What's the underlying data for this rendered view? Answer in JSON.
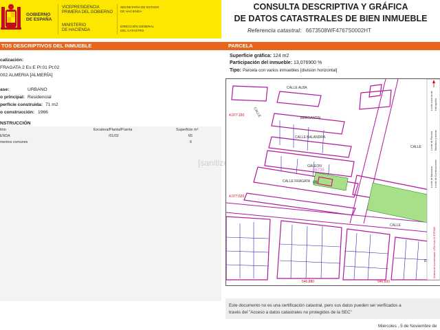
{
  "header": {
    "gov_line1": "GOBIERNO",
    "gov_line2": "DE ESPAÑA",
    "ministry_a1": "VICEPRESIDENCIA",
    "ministry_a2": "PRIMERA DEL GOBIERNO",
    "ministry_b1": "MINISTERIO",
    "ministry_b2": "DE HACIENDA",
    "sec_a1": "SECRETARÍA DE ESTADO",
    "sec_a2": "DE HACIENDA",
    "sec_b1": "DIRECCIÓN GENERAL",
    "sec_b2": "DEL CATASTRO",
    "title_line1": "CONSULTA DESCRIPTIVA Y GRÁFICA",
    "title_line2": "DE DATOS CATASTRALES DE BIEN INMUEBLE",
    "ref_label": "Referencia catastral:",
    "ref_value": "6673508WF4767S0002HT",
    "brand_red": "#c60b1e",
    "brand_yellow": "#fde700",
    "accent_orange": "#e8661c"
  },
  "left": {
    "section_title": "TOS DESCRIPTIVOS DEL INMUEBLE",
    "loc_label": "calización:",
    "address_line1": "FRAGATA 2 Es:E Pl:01 Pt:02",
    "address_line2": "002 ALMERIA [ALMERÍA]",
    "class_label": "ase:",
    "class_value": "URBANO",
    "use_label": "o principal:",
    "use_value": "Residencial",
    "area_label": "perficie construida:",
    "area_value": "71 m2",
    "year_label": "o construcción:",
    "year_value": "1966",
    "constr_title": "NSTRUCCIÓN",
    "columns": [
      "tino",
      "Escalera/Planta/Puerta",
      "Superficie m²"
    ],
    "rows": [
      {
        "dest": "ENDA",
        "spp": "/01/02",
        "sup": "65"
      },
      {
        "dest": "mentos comunes",
        "spp": "",
        "sup": "6"
      }
    ]
  },
  "right": {
    "section_title": "PARCELA",
    "graphic_label": "Superficie gráfica:",
    "graphic_value": "124 m2",
    "part_label": "Participación del inmueble:",
    "part_value": "13,076900 %",
    "type_label": "Tipo:",
    "type_value": "Parcela con varios inmuebles [division horizontal]"
  },
  "map": {
    "coord_y1": "4.077.150",
    "coord_y2": "4.077.020",
    "coord_x1": "546,880",
    "coord_x2": "546,600",
    "labels": {
      "calle_alba": "CALLE ALBA",
      "calle_a": "CALLE",
      "bergantin": "BERGANTIN",
      "calle_balandra": "CALLE BALANDRA",
      "galeon": "GALEON",
      "calle_fragata": "CALLE FRAGATA",
      "calle_b": "CALLE",
      "calle_c": "CALLE",
      "parcel_num": "08",
      "parcel_ref": "66735",
      "escala": "Escala"
    },
    "legend": [
      "Límite de Manzana",
      "Límite de Parcela",
      "Límite de Construcciones",
      "Mobiliario y aceras",
      "Límite zona verde",
      "Hidrografía"
    ],
    "legend_footer": "Sistema de Coordenadas: UTM Huso 30 ETRS89"
  },
  "footer": {
    "note_line1": "Este documento no es una certificación catastral, pero sus datos pueden ser verificados a",
    "note_line2": "través del \"Acceso a datos catastrales no protegidos de la SEC\"",
    "date": "Miércoles , 5 de Noviembre de"
  },
  "watermark": "[sanitized]"
}
